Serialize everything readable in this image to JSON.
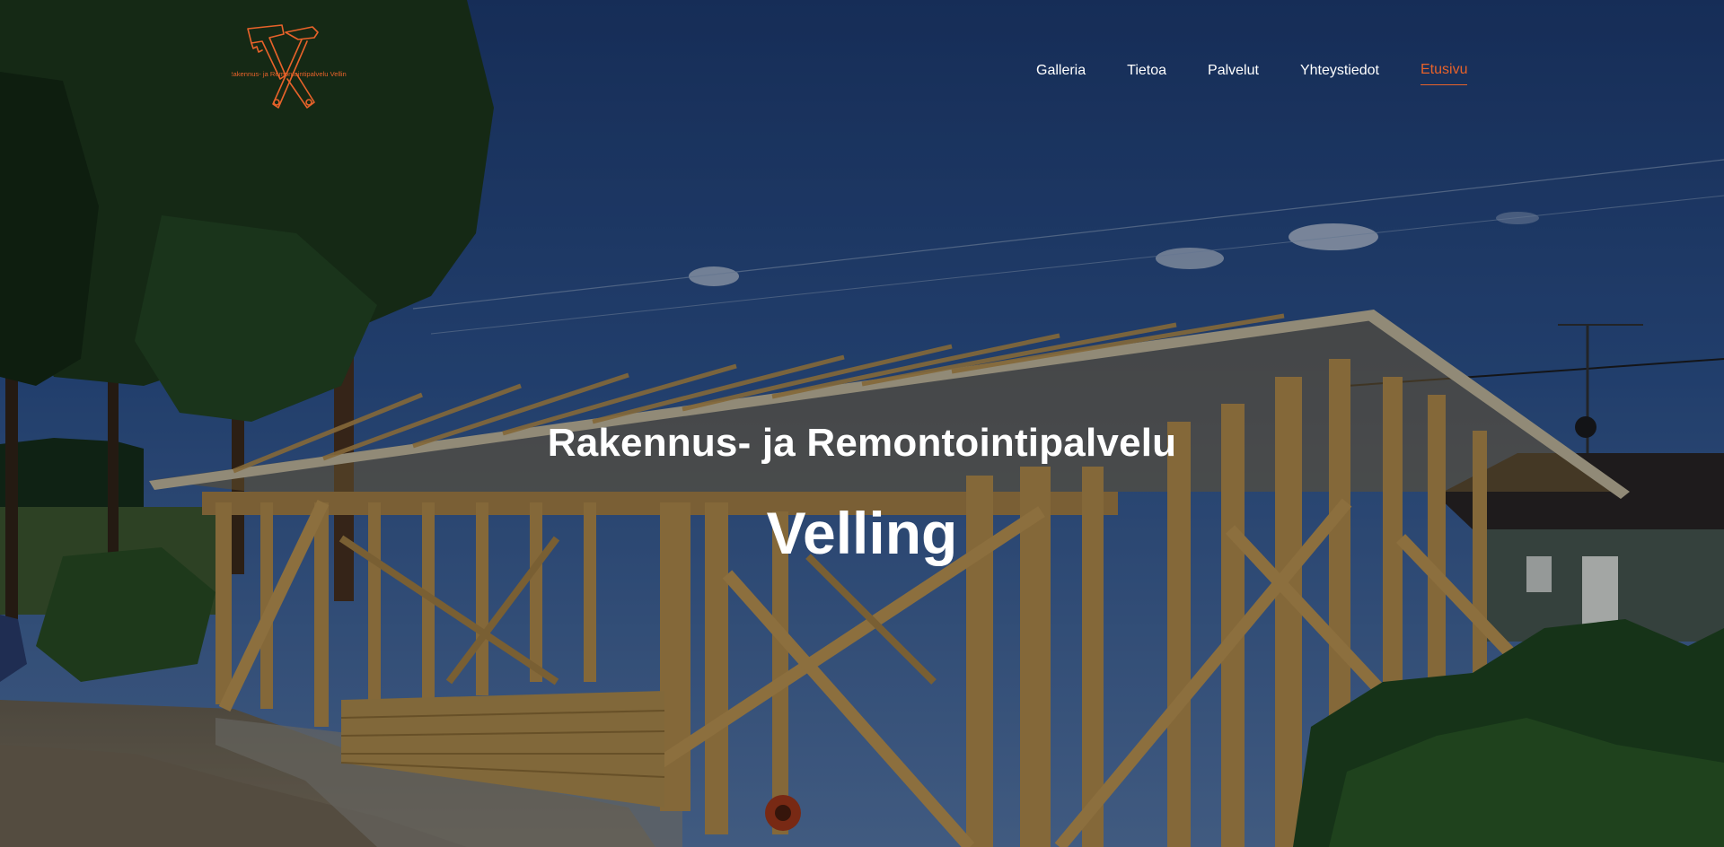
{
  "logo": {
    "text": "Rakennus- ja Remontointipalvelu Velling",
    "color": "#e7622a"
  },
  "nav": {
    "items": [
      {
        "label": "Galleria",
        "active": false
      },
      {
        "label": "Tietoa",
        "active": false
      },
      {
        "label": "Palvelut",
        "active": false
      },
      {
        "label": "Yhteystiedot",
        "active": false
      },
      {
        "label": "Etusivu",
        "active": true
      }
    ],
    "active_color": "#e7622a"
  },
  "hero": {
    "title": "Rakennus- ja Remontointipalvelu",
    "subtitle": "Velling"
  }
}
